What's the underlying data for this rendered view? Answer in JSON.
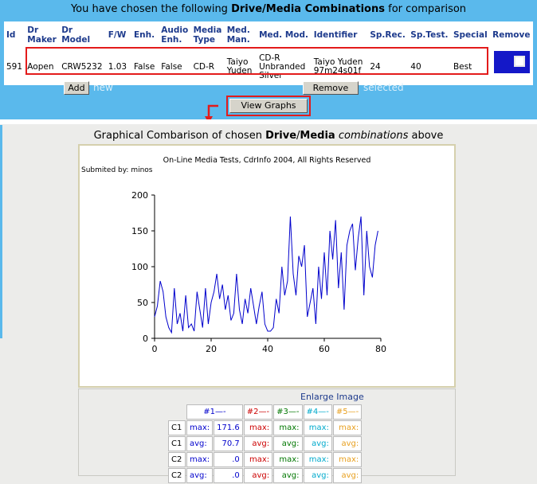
{
  "heading": {
    "prefix": "You have chosen the following ",
    "bold": "Drive/Media Combinations",
    "suffix": " for comparison"
  },
  "table": {
    "headers": [
      "Id",
      "Dr Maker",
      "Dr Model",
      "F/W",
      "Enh.",
      "Audio Enh.",
      "Media Type",
      "Med. Man.",
      "Med. Mod.",
      "Identifier",
      "Sp.Rec.",
      "Sp.Test.",
      "Special",
      "Remove"
    ],
    "row": [
      "591",
      "Aopen",
      "CRW5232",
      "1.03",
      "False",
      "False",
      "CD-R",
      "Taiyo Yuden",
      "CD-R Unbranded Silver",
      "Taiyo Yuden 97m24s01f",
      "24",
      "40",
      "Best",
      ""
    ]
  },
  "buttons": {
    "add": "Add",
    "add_hint": "new",
    "remove": "Remove",
    "remove_hint": "selected",
    "view_graphs": "View Graphs"
  },
  "graph_title": {
    "prefix": "Graphical Combarison of chosen ",
    "bold1": "Drive",
    "slash": "/",
    "bold2": "Media",
    "italic": "combinations",
    "suffix": " above"
  },
  "chart_data": {
    "type": "line",
    "title": "On-Line Media Tests, CdrInfo 2004, All Rights Reserved",
    "subtitle": "Submited by: minos",
    "xlim": [
      0,
      80
    ],
    "ylim": [
      0,
      200
    ],
    "xticks": [
      0,
      20,
      40,
      60,
      80
    ],
    "yticks": [
      0,
      50,
      100,
      150,
      200
    ],
    "grid": false,
    "color": "#0000cc",
    "x": [
      0,
      1,
      2,
      3,
      4,
      5,
      6,
      7,
      8,
      9,
      10,
      11,
      12,
      13,
      14,
      15,
      16,
      17,
      18,
      19,
      20,
      21,
      22,
      23,
      24,
      25,
      26,
      27,
      28,
      29,
      30,
      31,
      32,
      33,
      34,
      35,
      36,
      37,
      38,
      39,
      40,
      41,
      42,
      43,
      44,
      45,
      46,
      47,
      48,
      49,
      50,
      51,
      52,
      53,
      54,
      55,
      56,
      57,
      58,
      59,
      60,
      61,
      62,
      63,
      64,
      65,
      66,
      67,
      68,
      69,
      70,
      71,
      72,
      73,
      74,
      75,
      76,
      77,
      78,
      79
    ],
    "y": [
      30,
      45,
      80,
      65,
      30,
      15,
      8,
      70,
      20,
      35,
      10,
      60,
      15,
      20,
      10,
      65,
      40,
      15,
      70,
      20,
      50,
      65,
      90,
      55,
      75,
      40,
      60,
      25,
      35,
      90,
      40,
      20,
      55,
      35,
      70,
      45,
      20,
      45,
      65,
      20,
      10,
      10,
      15,
      55,
      35,
      100,
      60,
      80,
      170,
      90,
      60,
      115,
      100,
      130,
      30,
      50,
      70,
      20,
      100,
      55,
      120,
      60,
      150,
      110,
      165,
      70,
      120,
      40,
      130,
      150,
      160,
      95,
      140,
      170,
      60,
      150,
      100,
      85,
      130,
      150
    ]
  },
  "legend": {
    "enlarge": "Enlarge Image",
    "cols": [
      "#1—-",
      "#2—-",
      "#3—-",
      "#4—-",
      "#5—-"
    ],
    "col_colors": [
      "#0000cc",
      "#cc0000",
      "#007700",
      "#00aacc",
      "#e8a020"
    ],
    "rows": [
      {
        "label": "C1",
        "kind": "max:",
        "v1": "171.6"
      },
      {
        "label": "C1",
        "kind": "avg:",
        "v1": "70.7"
      },
      {
        "label": "C2",
        "kind": "max:",
        "v1": ".0"
      },
      {
        "label": "C2",
        "kind": "avg:",
        "v1": ".0"
      }
    ]
  }
}
